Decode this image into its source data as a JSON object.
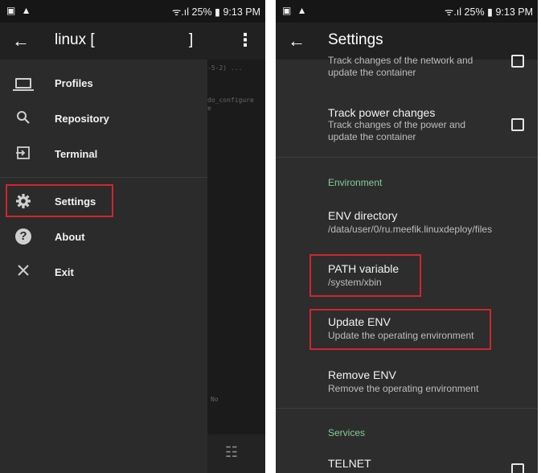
{
  "left": {
    "status": {
      "left_icons": "▣ ▲",
      "signal": "ᯤ.ıl",
      "battery": "25%",
      "time": "9:13 PM"
    },
    "toolbar": {
      "back_icon": "←",
      "title": "linux  [",
      "bracket": "]",
      "more_icon": "⋮"
    },
    "background": {
      "line1": "-5-2) ...",
      "line2": "do_configure",
      "line3": "e",
      "no_text": "No",
      "tune_icon": "☷"
    },
    "drawer": {
      "items": [
        {
          "label": "Profiles",
          "icon": "laptop-icon"
        },
        {
          "label": "Repository",
          "icon": "search-icon"
        },
        {
          "label": "Terminal",
          "icon": "terminal-icon"
        },
        {
          "label": "Settings",
          "icon": "gear-icon"
        },
        {
          "label": "About",
          "icon": "help-icon"
        },
        {
          "label": "Exit",
          "icon": "close-icon"
        }
      ]
    }
  },
  "right": {
    "status": {
      "left_icons": "▣ ▲",
      "signal": "ᯤ.ıl",
      "battery": "25%",
      "time": "9:13 PM"
    },
    "toolbar": {
      "back_icon": "←",
      "title": "Settings"
    },
    "prefs": {
      "network": {
        "summary_line1": "Track changes of the network and",
        "summary_line2": "update the container"
      },
      "power": {
        "title": "Track power changes",
        "summary_line1": "Track changes of the power and",
        "summary_line2": "update the container"
      },
      "env_section": "Environment",
      "env_dir": {
        "title": "ENV directory",
        "summary": "/data/user/0/ru.meefik.linuxdeploy/files"
      },
      "path_var": {
        "title": "PATH variable",
        "summary": "/system/xbin"
      },
      "update_env": {
        "title": "Update ENV",
        "summary": "Update the operating environment"
      },
      "remove_env": {
        "title": "Remove ENV",
        "summary": "Remove the operating environment"
      },
      "services_section": "Services",
      "telnet": {
        "title": "TELNET"
      }
    }
  },
  "colors": {
    "highlight": "#d0262c",
    "section_accent": "#7fcf9a",
    "toolbar": "#212121"
  }
}
